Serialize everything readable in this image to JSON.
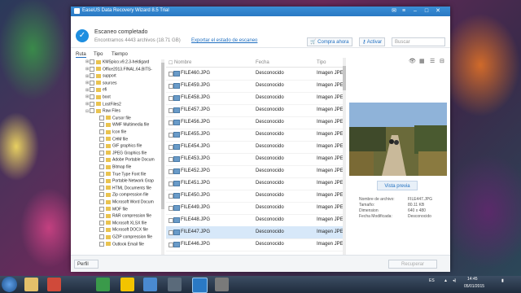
{
  "window": {
    "title": "EaseUS Data Recovery Wizard 8.5 Trial"
  },
  "header": {
    "scan_title": "Escaneo completado",
    "scan_sub": "Encontrarnos 4443 archivos (18.71 GB)",
    "export_link": "Exportar el estado de escaneo",
    "buy_label": "Compra ahora",
    "activate_label": "Activar",
    "search_placeholder": "Buscar"
  },
  "tabs": [
    "Ruta",
    "Tipo",
    "Tiempo"
  ],
  "tree": [
    "KMSpico.v9.2.3-heldigard",
    "Office2013.FINAL.64.BITS-",
    "support",
    "sources",
    "efi",
    "boot",
    "LostFiles2",
    "Raw Files",
    "Cursor file",
    "WMF Multimedia file",
    "Icon file",
    "CHM file",
    "GIF graphics file",
    "JPEG Graphics file",
    "Adobe Portable Docum",
    "Bitmap file",
    "True Type Font file",
    "Portable Network Grap",
    "HTML Documents file",
    "Zip compression file",
    "Microsoft Word Docum",
    "MOF file",
    "RAR compression file",
    "Microsoft XLSX file",
    "Microsoft DOCX file",
    "GZIP compression file",
    "Outlook Email file"
  ],
  "filelist": {
    "columns": [
      "Nombre",
      "Fecha",
      "Tipo"
    ],
    "rows": [
      [
        "FILE460.JPG",
        "Desconocido",
        "Imagen JPE"
      ],
      [
        "FILE459.JPG",
        "Desconocido",
        "Imagen JPE"
      ],
      [
        "FILE458.JPG",
        "Desconocido",
        "Imagen JPE"
      ],
      [
        "FILE457.JPG",
        "Desconocido",
        "Imagen JPE"
      ],
      [
        "FILE456.JPG",
        "Desconocido",
        "Imagen JPE"
      ],
      [
        "FILE455.JPG",
        "Desconocido",
        "Imagen JPE"
      ],
      [
        "FILE454.JPG",
        "Desconocido",
        "Imagen JPE"
      ],
      [
        "FILE453.JPG",
        "Desconocido",
        "Imagen JPE"
      ],
      [
        "FILE452.JPG",
        "Desconocido",
        "Imagen JPE"
      ],
      [
        "FILE451.JPG",
        "Desconocido",
        "Imagen JPE"
      ],
      [
        "FILE450.JPG",
        "Desconocido",
        "Imagen JPE"
      ],
      [
        "FILE449.JPG",
        "Desconocido",
        "Imagen JPE"
      ],
      [
        "FILE448.JPG",
        "Desconocido",
        "Imagen JPE"
      ],
      [
        "FILE447.JPG",
        "Desconocido",
        "Imagen JPE"
      ],
      [
        "FILE446.JPG",
        "Desconocido",
        "Imagen JPE"
      ]
    ],
    "selected_index": 13
  },
  "preview": {
    "button_label": "Vista previa",
    "labels": [
      "Nombre de archivo:",
      "Tamaño:",
      "Dimension",
      "Fecha Modificada:"
    ],
    "values": [
      "FILE447.JPG",
      "80.11 KB",
      "640 x 480",
      "Desconocido"
    ]
  },
  "footer": {
    "back_label": "Perfil",
    "recover_label": "Recuperar"
  },
  "taskbar": {
    "lang": "ES",
    "time": "14:45",
    "date": "05/01/2015"
  },
  "colors": {
    "accent": "#1e8ee0",
    "title_bar": "#2a79c4",
    "selection": "#d7e8f9"
  }
}
